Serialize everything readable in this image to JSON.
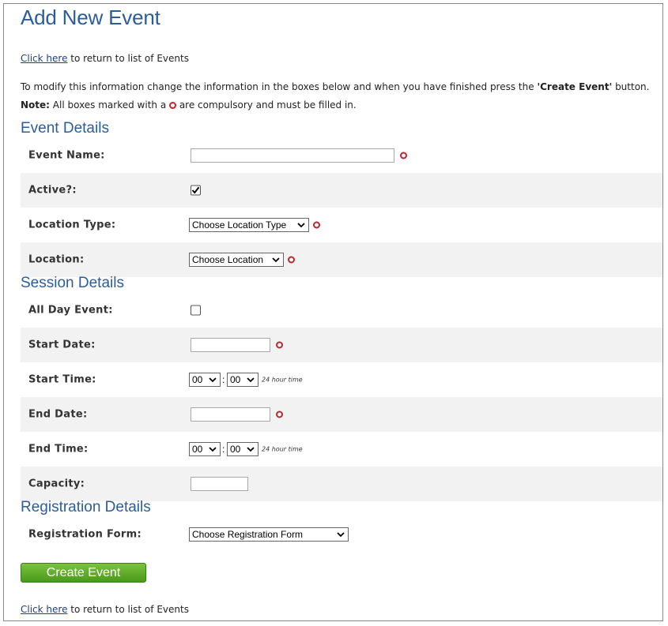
{
  "page": {
    "title": "Add New Event",
    "back_link_text": "Click here",
    "back_link_suffix": " to return to list of Events",
    "intro_text": "To modify this information change the information in the boxes below and when you have finished press the ",
    "intro_button_ref": "'Create Event'",
    "intro_suffix": " button.",
    "note_label": "Note:",
    "note_prefix": " All boxes marked with a ",
    "note_suffix": " are compulsory and must be filled in."
  },
  "event_details": {
    "heading": "Event Details",
    "event_name": {
      "label": "Event Name:",
      "value": "",
      "required": true
    },
    "active": {
      "label": "Active?:",
      "checked": true
    },
    "location_type": {
      "label": "Location Type:",
      "selected": "Choose Location Type",
      "required": true
    },
    "location": {
      "label": "Location:",
      "selected": "Choose Location",
      "required": true
    }
  },
  "session_details": {
    "heading": "Session Details",
    "all_day": {
      "label": "All Day Event:",
      "checked": false
    },
    "start_date": {
      "label": "Start Date:",
      "value": "",
      "required": true
    },
    "start_time": {
      "label": "Start Time:",
      "hour": "00",
      "minute": "00",
      "separator": ":",
      "hint": "24 hour time"
    },
    "end_date": {
      "label": "End Date:",
      "value": "",
      "required": true
    },
    "end_time": {
      "label": "End Time:",
      "hour": "00",
      "minute": "00",
      "separator": ":",
      "hint": "24 hour time"
    },
    "capacity": {
      "label": "Capacity:",
      "value": ""
    }
  },
  "registration_details": {
    "heading": "Registration Details",
    "registration_form": {
      "label": "Registration Form:",
      "selected": "Choose Registration Form"
    }
  },
  "actions": {
    "create_button": "Create Event"
  },
  "colors": {
    "heading": "#2a5d9c",
    "required_marker": "#c0262b",
    "button_green": "#5aab27",
    "shaded_row": "#f2f2f2"
  }
}
